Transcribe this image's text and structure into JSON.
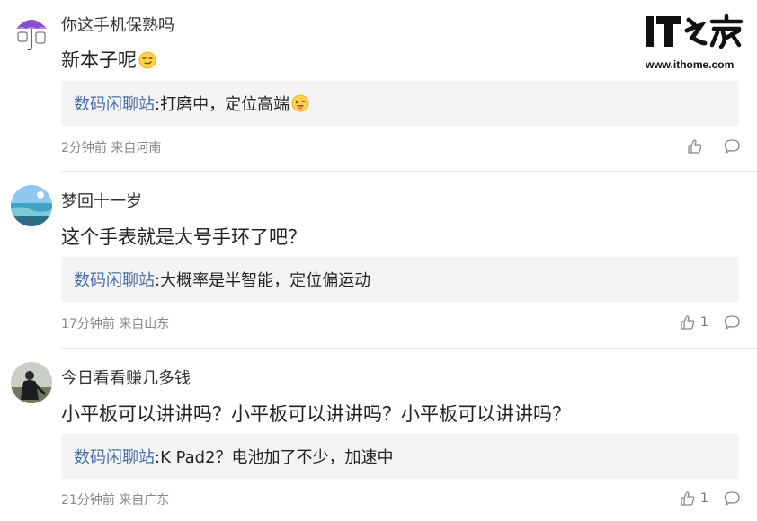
{
  "site": {
    "logo_text": "IT之家",
    "url": "www.ithome.com"
  },
  "comments": [
    {
      "username": "你这手机保熟吗",
      "avatar": "purple-umbrella-avatar",
      "content": "新本子呢",
      "content_emoji": "smirk-emoji",
      "reply_author": "数码闲聊站",
      "reply_text": ":打磨中，定位高端",
      "reply_emoji": "wink-tongue-emoji",
      "time": "2分钟前",
      "location": "来自河南",
      "likes": ""
    },
    {
      "username": "梦回十一岁",
      "avatar": "seaside-avatar",
      "content": "这个手表就是大号手环了吧？",
      "reply_author": "数码闲聊站",
      "reply_text": ":大概率是半智能，定位偏运动",
      "time": "17分钟前",
      "location": "来自山东",
      "likes": "1"
    },
    {
      "username": "今日看看赚几多钱",
      "avatar": "person-photo-avatar",
      "content": "小平板可以讲讲吗？小平板可以讲讲吗？小平板可以讲讲吗？",
      "reply_author": "数码闲聊站",
      "reply_text": ":K Pad2？电池加了不少，加速中",
      "time": "21分钟前",
      "location": "来自广东",
      "likes": "1"
    }
  ],
  "colors": {
    "reply_author": "#4a6fa5",
    "reply_bg": "#f4f4f4",
    "meta": "#888888",
    "divider": "#e6e6e6"
  },
  "icons": {
    "like": "thumbs-up-icon",
    "reply": "speech-bubble-icon"
  }
}
